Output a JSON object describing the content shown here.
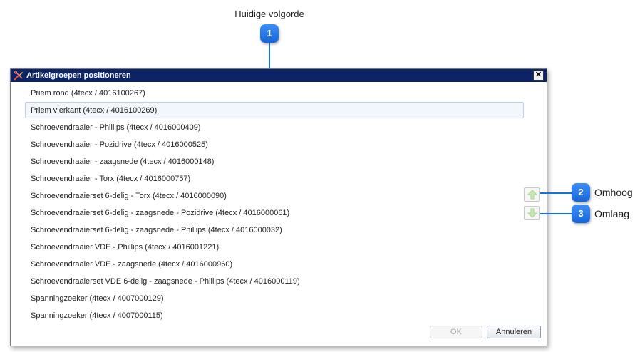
{
  "callouts": {
    "top_label": "Huidige volgorde",
    "badge1": "1",
    "badge2": "2",
    "badge2_label": "Omhoog",
    "badge3": "3",
    "badge3_label": "Omlaag"
  },
  "dialog": {
    "title": "Artikelgroepen positioneren",
    "close_symbol": "✕",
    "items": [
      "Priem rond (4tecx / 4016100267)",
      "Priem vierkant (4tecx / 4016100269)",
      "Schroevendraaier - Phillips (4tecx / 4016000409)",
      "Schroevendraaier - Pozidrive (4tecx / 4016000525)",
      "Schroevendraaier - zaagsnede (4tecx / 4016000148)",
      "Schroevendraaier - Torx (4tecx / 4016000757)",
      "Schroevendraaierset 6-delig - Torx (4tecx / 4016000090)",
      "Schroevendraaierset 6-delig - zaagsnede - Pozidrive (4tecx / 4016000061)",
      "Schroevendraaierset 6-delig - zaagsnede - Phillips (4tecx / 4016000032)",
      "Schroevendraaier VDE - Phillips (4tecx / 4016001221)",
      "Schroevendraaier VDE - zaagsnede (4tecx / 4016000960)",
      "Schroevendraaierset VDE 6-delig - zaagsnede - Phillips (4tecx / 4016000119)",
      "Spanningzoeker (4tecx / 4007000129)",
      "Spanningzoeker (4tecx / 4007000115)"
    ],
    "selected_index": 1,
    "ok_label": "OK",
    "cancel_label": "Annuleren"
  },
  "colors": {
    "titlebar": "#0c2366",
    "badge": "#1565d8",
    "arrow": "#8fd16a"
  },
  "icons": {
    "app": "tools-icon",
    "close": "close-icon",
    "up": "arrow-up-icon",
    "down": "arrow-down-icon"
  }
}
